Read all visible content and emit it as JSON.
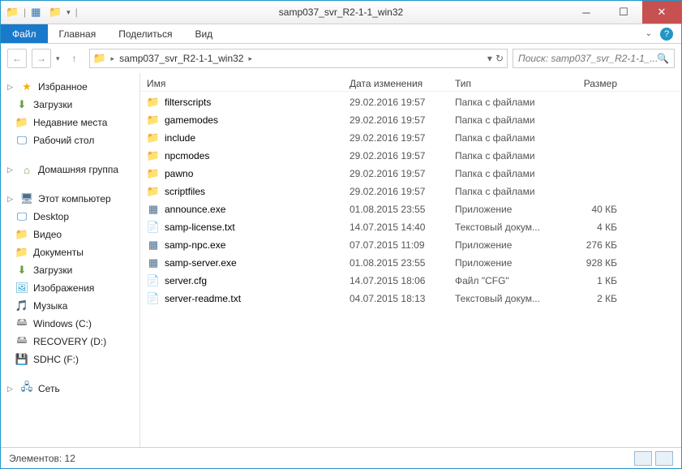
{
  "title": "samp037_svr_R2-1-1_win32",
  "tabs": {
    "file": "Файл",
    "home": "Главная",
    "share": "Поделиться",
    "view": "Вид"
  },
  "breadcrumb": {
    "folder": "samp037_svr_R2-1-1_win32"
  },
  "search_placeholder": "Поиск: samp037_svr_R2-1-1_...",
  "sidebar": {
    "favorites": {
      "label": "Избранное",
      "items": [
        {
          "icon": "download",
          "label": "Загрузки"
        },
        {
          "icon": "folder",
          "label": "Недавние места"
        },
        {
          "icon": "desktop",
          "label": "Рабочий стол"
        }
      ]
    },
    "homegroup": {
      "label": "Домашняя группа"
    },
    "computer": {
      "label": "Этот компьютер",
      "items": [
        {
          "icon": "desktop",
          "label": "Desktop"
        },
        {
          "icon": "folder",
          "label": "Видео"
        },
        {
          "icon": "folder",
          "label": "Документы"
        },
        {
          "icon": "download",
          "label": "Загрузки"
        },
        {
          "icon": "pic",
          "label": "Изображения"
        },
        {
          "icon": "music",
          "label": "Музыка"
        },
        {
          "icon": "drive",
          "label": "Windows (C:)"
        },
        {
          "icon": "drive",
          "label": "RECOVERY (D:)"
        },
        {
          "icon": "sd",
          "label": "SDHC (F:)"
        }
      ]
    },
    "network": {
      "label": "Сеть"
    }
  },
  "columns": {
    "name": "Имя",
    "date": "Дата изменения",
    "type": "Тип",
    "size": "Размер"
  },
  "files": [
    {
      "icon": "folder",
      "name": "filterscripts",
      "date": "29.02.2016 19:57",
      "type": "Папка с файлами",
      "size": ""
    },
    {
      "icon": "folder",
      "name": "gamemodes",
      "date": "29.02.2016 19:57",
      "type": "Папка с файлами",
      "size": ""
    },
    {
      "icon": "folder",
      "name": "include",
      "date": "29.02.2016 19:57",
      "type": "Папка с файлами",
      "size": ""
    },
    {
      "icon": "folder",
      "name": "npcmodes",
      "date": "29.02.2016 19:57",
      "type": "Папка с файлами",
      "size": ""
    },
    {
      "icon": "folder",
      "name": "pawno",
      "date": "29.02.2016 19:57",
      "type": "Папка с файлами",
      "size": ""
    },
    {
      "icon": "folder",
      "name": "scriptfiles",
      "date": "29.02.2016 19:57",
      "type": "Папка с файлами",
      "size": ""
    },
    {
      "icon": "exe",
      "name": "announce.exe",
      "date": "01.08.2015 23:55",
      "type": "Приложение",
      "size": "40 КБ"
    },
    {
      "icon": "txt",
      "name": "samp-license.txt",
      "date": "14.07.2015 14:40",
      "type": "Текстовый докум...",
      "size": "4 КБ"
    },
    {
      "icon": "exe",
      "name": "samp-npc.exe",
      "date": "07.07.2015 11:09",
      "type": "Приложение",
      "size": "276 КБ"
    },
    {
      "icon": "exe",
      "name": "samp-server.exe",
      "date": "01.08.2015 23:55",
      "type": "Приложение",
      "size": "928 КБ"
    },
    {
      "icon": "cfg",
      "name": "server.cfg",
      "date": "14.07.2015 18:06",
      "type": "Файл \"CFG\"",
      "size": "1 КБ"
    },
    {
      "icon": "txt",
      "name": "server-readme.txt",
      "date": "04.07.2015 18:13",
      "type": "Текстовый докум...",
      "size": "2 КБ"
    }
  ],
  "status": {
    "label": "Элементов:",
    "count": "12"
  }
}
